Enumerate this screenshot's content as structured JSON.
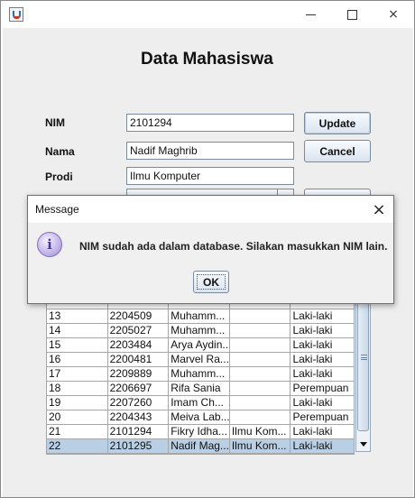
{
  "window": {
    "controls": {
      "minimize": "min-icon",
      "maximize": "max-icon",
      "close": "×"
    }
  },
  "page_title": "Data Mahasiswa",
  "form": {
    "nim_label": "NIM",
    "nim_value": "2101294",
    "nama_label": "Nama",
    "nama_value": "Nadif Maghrib",
    "prodi_label": "Prodi",
    "prodi_value": "Ilmu Komputer"
  },
  "buttons": {
    "update": "Update",
    "cancel": "Cancel"
  },
  "table": {
    "rows": [
      [
        "13",
        "2204509",
        "Muhamm...",
        "",
        "Laki-laki"
      ],
      [
        "14",
        "2205027",
        "Muhamm...",
        "",
        "Laki-laki"
      ],
      [
        "15",
        "2203484",
        "Arya Aydin...",
        "",
        "Laki-laki"
      ],
      [
        "16",
        "2200481",
        "Marvel Ra...",
        "",
        "Laki-laki"
      ],
      [
        "17",
        "2209889",
        "Muhamm...",
        "",
        "Laki-laki"
      ],
      [
        "18",
        "2206697",
        "Rifa Sania",
        "",
        "Perempuan"
      ],
      [
        "19",
        "2207260",
        "Imam Ch...",
        "",
        "Laki-laki"
      ],
      [
        "20",
        "2204343",
        "Meiva Lab...",
        "",
        "Perempuan"
      ],
      [
        "21",
        "2101294",
        "Fikry Idha...",
        "Ilmu Kom...",
        "Laki-laki"
      ],
      [
        "22",
        "2101295",
        "Nadif Mag...",
        "Ilmu Kom...",
        "Laki-laki"
      ]
    ],
    "selected_row": "22"
  },
  "dialog": {
    "title": "Message",
    "close": "×",
    "icon": "info-icon",
    "icon_glyph": "i",
    "message": "NIM sudah ada dalam database. Silakan masukkan NIM lain.",
    "ok": "OK"
  }
}
